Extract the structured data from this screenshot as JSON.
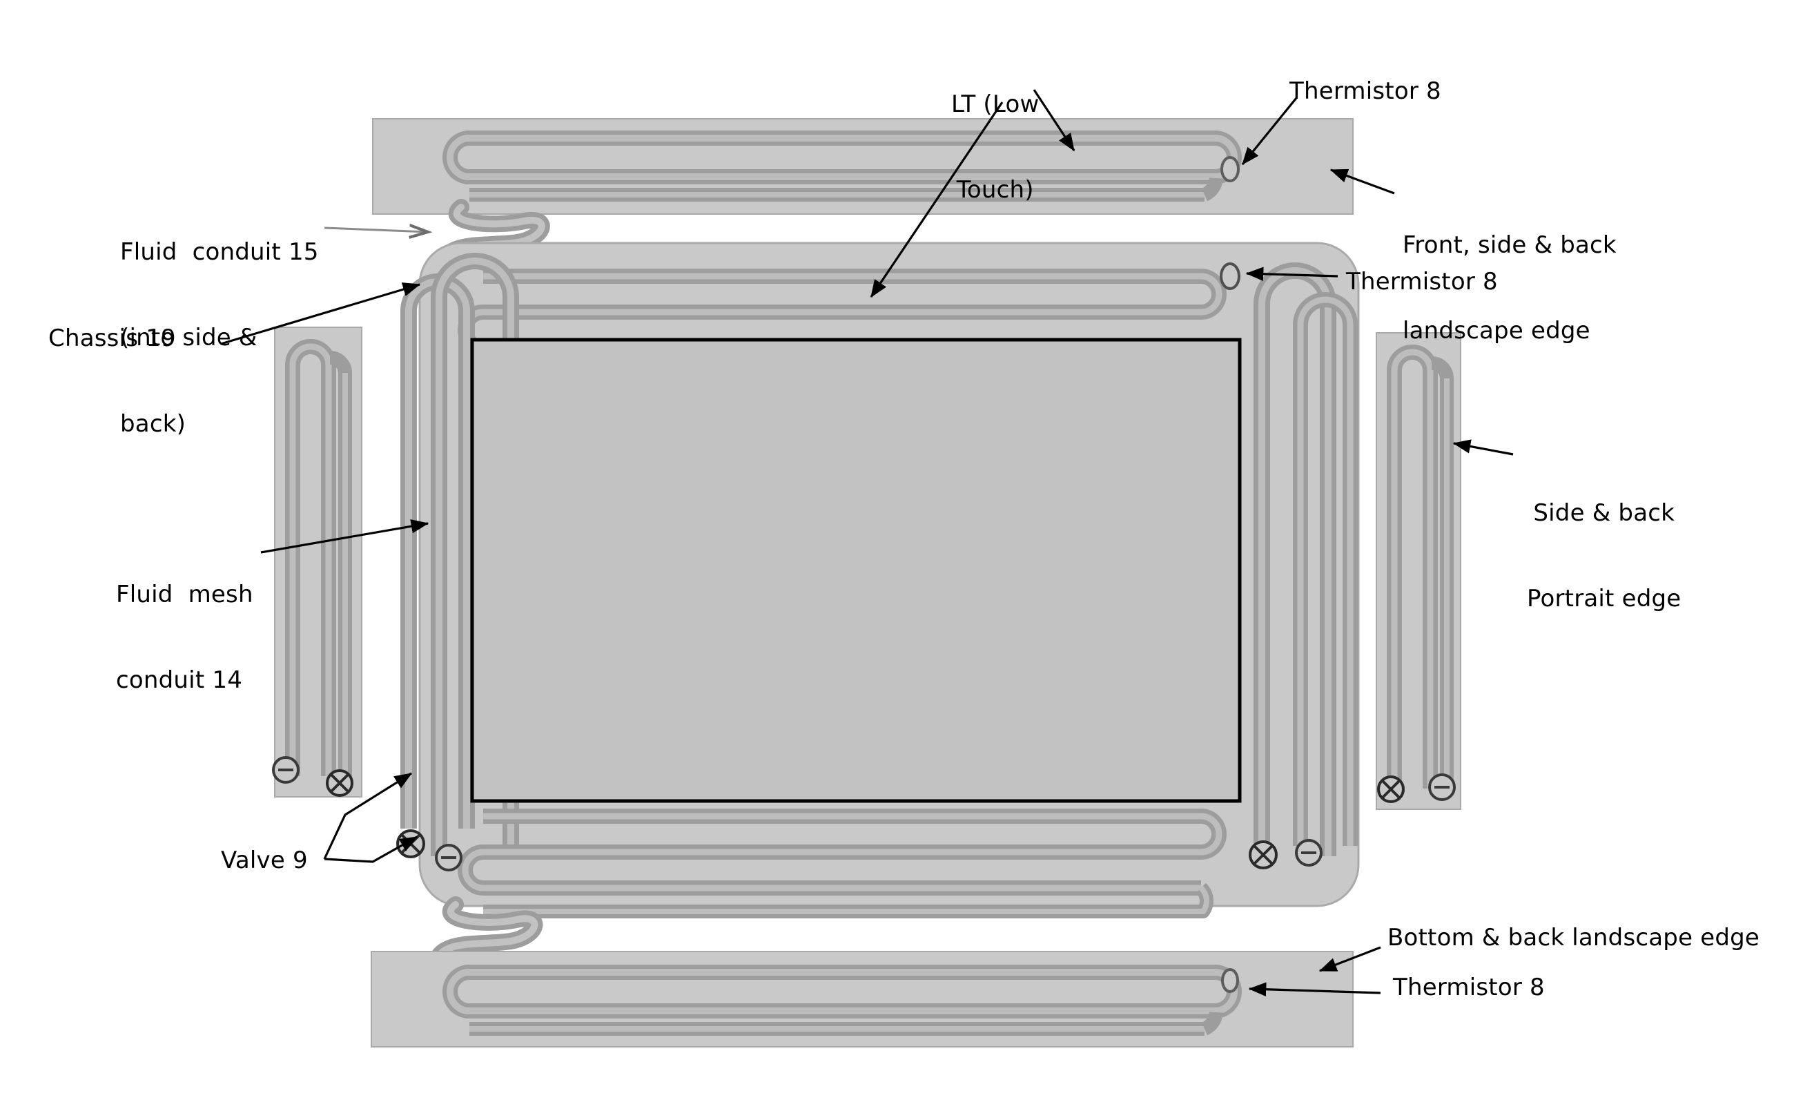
{
  "figure": {
    "kind": "patent-line-drawing",
    "subject": "Tablet device thermal fluid conduit layout",
    "colors": {
      "background": "#ffffff",
      "panel_fill": "#c9c9c9",
      "panel_stroke": "#a8a8a8",
      "tube_fill": "#a3a3a3",
      "tube_stroke": "#8f8f8f",
      "screen_fill": "#c2c2c2",
      "screen_stroke": "#000000",
      "leader_line": "#000000",
      "text": "#000000"
    }
  },
  "labels": {
    "lt_low_touch": {
      "line1": "LT (Low",
      "line2": "Touch)"
    },
    "thermistor_top": "Thermistor 8",
    "front_side_back_landscape_edge": {
      "line1": "Front, side & back",
      "line2": "landscape edge"
    },
    "fluid_conduit_15": {
      "line1": "Fluid  conduit 15",
      "line2": "(into side &",
      "line3": "back)"
    },
    "chassis_19": "Chassis 19",
    "thermistor_main": "Thermistor 8",
    "fluid_mesh_conduit_14": {
      "line1": "Fluid  mesh",
      "line2": "conduit 14"
    },
    "side_back_portrait_edge": {
      "line1": "Side & back",
      "line2": "Portrait edge"
    },
    "valve_9": "Valve 9",
    "bottom_back_landscape_edge": "Bottom & back landscape edge",
    "thermistor_bottom": "Thermistor 8"
  },
  "components": {
    "panels": [
      {
        "name": "top-landscape-edge-panel",
        "role": "Front, side & back landscape edge"
      },
      {
        "name": "left-portrait-edge-panel",
        "role": "Side & back Portrait edge"
      },
      {
        "name": "right-portrait-edge-panel",
        "role": "Side & back Portrait edge"
      },
      {
        "name": "bottom-landscape-edge-panel",
        "role": "Bottom & back landscape edge"
      },
      {
        "name": "main-chassis-19",
        "role": "Chassis 19 with display"
      }
    ],
    "thermistor_count": 3,
    "valve_symbols": [
      {
        "symbol": "circle-minus",
        "meaning": "valve closed / outlet"
      },
      {
        "symbol": "circle-cross",
        "meaning": "valve open / inlet"
      }
    ],
    "valve_instances": [
      {
        "panel": "left-portrait-edge-panel",
        "left": "circle-minus",
        "right": "circle-cross"
      },
      {
        "panel": "main-chassis-19",
        "left": "circle-cross",
        "right": "circle-minus"
      },
      {
        "panel": "main-chassis-19-right",
        "left": "circle-cross",
        "right": "circle-minus"
      },
      {
        "panel": "right-portrait-edge-panel",
        "left": "circle-cross",
        "right": "circle-minus"
      }
    ]
  }
}
